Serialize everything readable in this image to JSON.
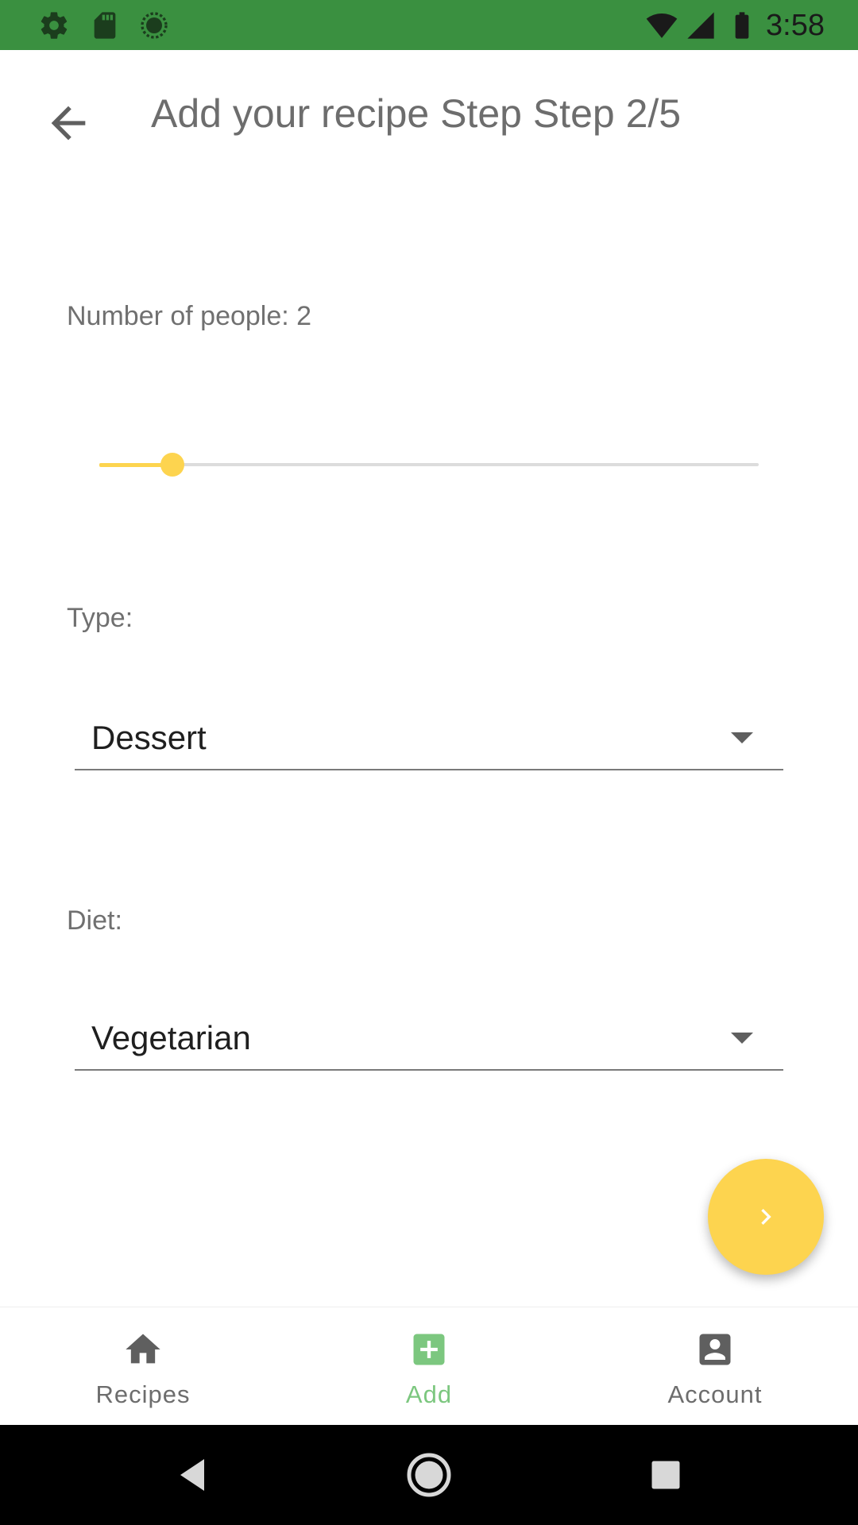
{
  "status_bar": {
    "time": "3:58",
    "background_color": "#3a9040",
    "icons_left": [
      "settings-icon",
      "sd-card-icon",
      "sync-icon"
    ],
    "icons_right": [
      "wifi-icon",
      "cellular-signal-icon",
      "battery-icon"
    ]
  },
  "app_bar": {
    "back_icon": "arrow-back-icon",
    "title": "Add your recipe Step Step 2/5"
  },
  "form": {
    "people": {
      "label": "Number of people: 2",
      "value": 2,
      "min": 1,
      "max": 10,
      "accent_color": "#fdd44f"
    },
    "type": {
      "label": "Type:",
      "selected": "Dessert"
    },
    "diet": {
      "label": "Diet:",
      "selected": "Vegetarian"
    }
  },
  "fab": {
    "icon": "chevron-right-icon",
    "color": "#fdd44f"
  },
  "bottom_nav": {
    "items": [
      {
        "label": "Recipes",
        "icon": "home-icon",
        "active": false
      },
      {
        "label": "Add",
        "icon": "add-box-icon",
        "active": true
      },
      {
        "label": "Account",
        "icon": "account-box-icon",
        "active": false
      }
    ],
    "active_color": "#7cc77f"
  },
  "system_nav": {
    "buttons": [
      "back-triangle-icon",
      "home-circle-icon",
      "recents-square-icon"
    ]
  }
}
